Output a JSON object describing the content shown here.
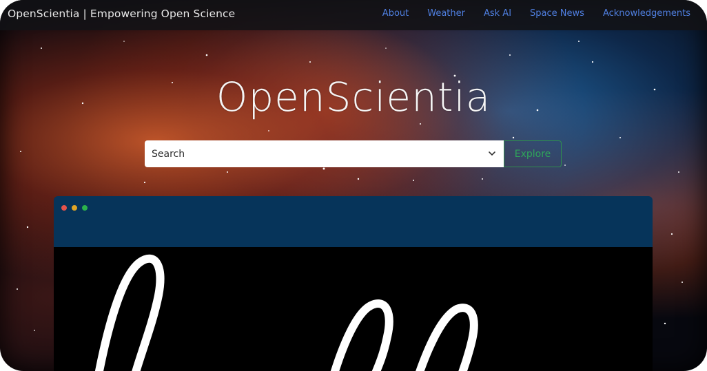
{
  "navbar": {
    "brand": "OpenScientia | Empowering Open Science",
    "links": [
      "About",
      "Weather",
      "Ask AI",
      "Space News",
      "Acknowledgements"
    ]
  },
  "hero": {
    "title": "OpenScientia",
    "search_select_value": "Search",
    "explore_label": "Explore"
  },
  "icons": {
    "select_arrow": "chevron-down-icon",
    "window_controls": [
      "close-dot",
      "minimize-dot",
      "maximize-dot"
    ]
  },
  "colors": {
    "nav_link": "#4f7fe0",
    "explore_accent": "#2fa55a",
    "window_header": "#06345a",
    "window_body": "#000000"
  }
}
